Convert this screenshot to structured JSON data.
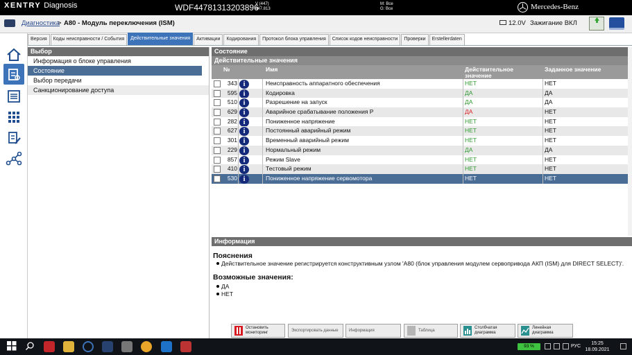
{
  "app": {
    "brand": "XENTRY",
    "name": "Diagnosis",
    "vin": "WDF44781313203896",
    "version_line1": "V (447)",
    "version_line2": "447.813",
    "mode_line1": "M: Все",
    "mode_line2": "G: Все",
    "maker": "Mercedes-Benz"
  },
  "breadcrumb": {
    "link": "Диагностика",
    "separator": ">",
    "title": "A80 - Модуль переключения (ISM)"
  },
  "status": {
    "voltage": "12.0V",
    "ignition": "Зажигание ВКЛ"
  },
  "tabs": [
    {
      "label": "Версия"
    },
    {
      "label": "Коды неисправности / События"
    },
    {
      "label": "Действительные значения"
    },
    {
      "label": "Активации"
    },
    {
      "label": "Кодирования"
    },
    {
      "label": "Протокол блока управления"
    },
    {
      "label": "Список кодов неисправности"
    },
    {
      "label": "Проверки"
    },
    {
      "label": "Erstellerdaten"
    }
  ],
  "selection": {
    "header": "Выбор",
    "items": [
      {
        "label": "Информация о блоке управления"
      },
      {
        "label": "Состояние"
      },
      {
        "label": "Выбор передачи"
      },
      {
        "label": "Санкционирование доступа"
      }
    ]
  },
  "state_panel": {
    "header": "Состояние",
    "subheader": "Действительные значения",
    "columns": {
      "num": "№",
      "name": "Имя",
      "actual": "Действительное значение",
      "set": "Заданное значение"
    },
    "rows": [
      {
        "num": "343",
        "name": "Неисправность аппаратного обеспечения",
        "actual": "НЕТ",
        "set": "НЕТ",
        "status": "ok"
      },
      {
        "num": "595",
        "name": "Кодировка",
        "actual": "ДА",
        "set": "ДА",
        "status": "ok"
      },
      {
        "num": "510",
        "name": "Разрешение на запуск",
        "actual": "ДА",
        "set": "ДА",
        "status": "ok"
      },
      {
        "num": "629",
        "name": "Аварийное срабатывание положения P",
        "actual": "ДА",
        "set": "НЕТ",
        "status": "bad"
      },
      {
        "num": "282",
        "name": "Пониженное напряжение",
        "actual": "НЕТ",
        "set": "НЕТ",
        "status": "ok"
      },
      {
        "num": "627",
        "name": "Постоянный аварийный режим",
        "actual": "НЕТ",
        "set": "НЕТ",
        "status": "ok"
      },
      {
        "num": "301",
        "name": "Временный аварийный режим",
        "actual": "НЕТ",
        "set": "НЕТ",
        "status": "ok"
      },
      {
        "num": "229",
        "name": "Нормальный режим",
        "actual": "ДА",
        "set": "ДА",
        "status": "ok"
      },
      {
        "num": "857",
        "name": "Режим Slave",
        "actual": "НЕТ",
        "set": "НЕТ",
        "status": "ok"
      },
      {
        "num": "410",
        "name": "Тестовый режим",
        "actual": "НЕТ",
        "set": "НЕТ",
        "status": "ok"
      },
      {
        "num": "530",
        "name": "Пониженное напряжение сервомотора",
        "actual": "НЕТ",
        "set": "НЕТ",
        "status": "ok"
      }
    ]
  },
  "info_panel": {
    "header": "Информация",
    "explain_title": "Пояснения",
    "explain_text": "Действительное значение регистрируется конструктивным узлом 'A80 (блок управления модулем сервопривода АКП (ISM) для DIRECT SELECT)'.",
    "possible_title": "Возможные значения:",
    "possible_values": [
      "ДА",
      "НЕТ"
    ]
  },
  "toolbar": {
    "stop": "Остановить мониторинг",
    "export": "Экспортировать данные",
    "info": "Информация",
    "table": "Таблица",
    "bar_chart": "Столбчатая диаграмма",
    "line_chart": "Линейная диаграмма"
  },
  "taskbar": {
    "battery": "93 %",
    "lang": "РУС",
    "time": "15:25",
    "date": "18.09.2021"
  },
  "colors": {
    "accent": "#3d73b8",
    "selected_row": "#4a6d96",
    "ok": "#2f9a2f",
    "bad": "#dd2222"
  }
}
